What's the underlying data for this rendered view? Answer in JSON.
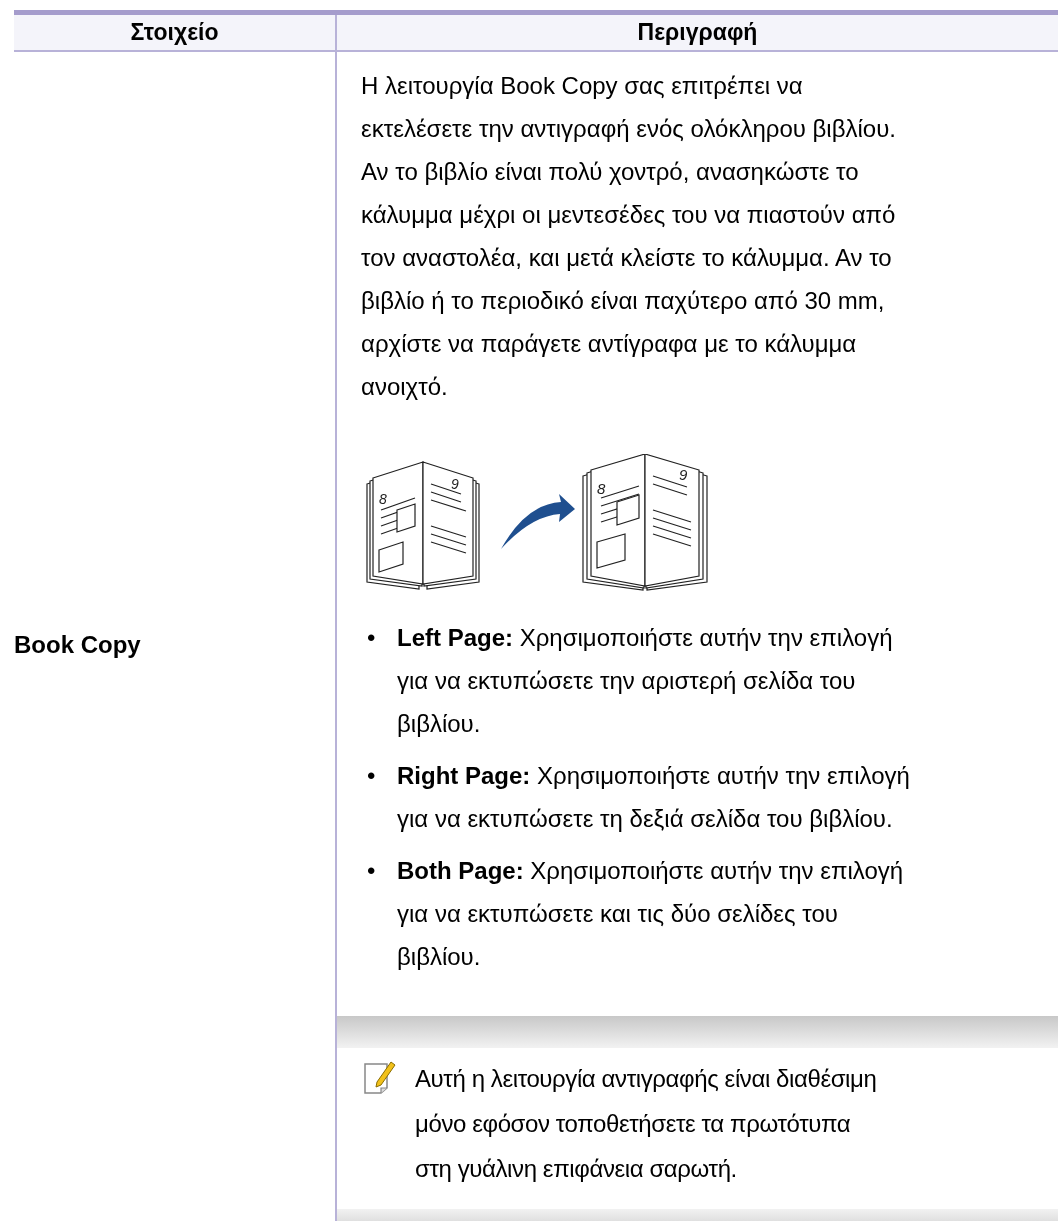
{
  "table": {
    "columns": [
      "Στοιχείο",
      "Περιγραφή"
    ],
    "rows": [
      {
        "item": "Book Copy",
        "description": "Η λειτουργία Book Copy σας επιτρέπει να\nεκτελέσετε την αντιγραφή ενός ολόκληρου βιβλίου.\nΑν το βιβλίο είναι πολύ χοντρό, ανασηκώστε το\nκάλυμμα μέχρι οι μεντεσέδες του να πιαστούν από\nτον αναστολέα, και μετά κλείστε το κάλυμμα. Αν το\nβιβλίο ή το περιοδικό είναι παχύτερο από 30 mm,\nαρχίστε να παράγετε αντίγραφα με το κάλυμμα\nανοιχτό.",
        "illustration_page_numbers": [
          "8",
          "9",
          "8",
          "9"
        ],
        "options": [
          {
            "bullet": "•",
            "text": "**Left Page:** Χρησιμοποιήστε αυτήν την επιλογή\nγια να εκτυπώσετε την αριστερή σελίδα του\nβιβλίου."
          },
          {
            "bullet": "•",
            "text": "**Right Page:** Χρησιμοποιήστε αυτήν την επιλογή\nγια να εκτυπώσετε τη δεξιά σελίδα του βιβλίου."
          },
          {
            "bullet": "•",
            "text": "**Both Page:** Χρησιμοποιήστε αυτήν την επιλογή\nγια να εκτυπώσετε και τις δύο σελίδες του\nβιβλίου."
          }
        ],
        "note": "Αυτή η λειτουργία αντιγραφής είναι διαθέσιμη\nμόνο εφόσον τοποθετήσετε τα πρωτότυπα\nστη γυάλινη επιφάνεια σαρωτή."
      }
    ]
  }
}
